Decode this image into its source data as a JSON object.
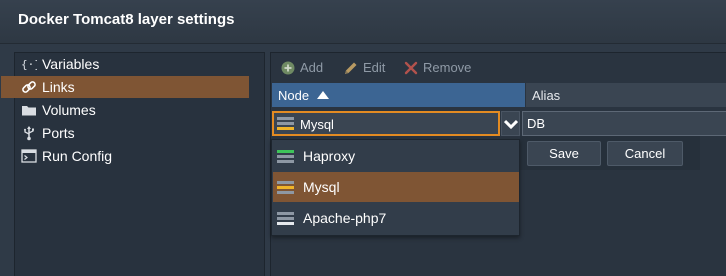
{
  "window": {
    "title": "Docker Tomcat8 layer settings"
  },
  "sidebar": {
    "items": [
      {
        "label": "Variables",
        "icon": "variables-icon",
        "active": false
      },
      {
        "label": "Links",
        "icon": "link-icon",
        "active": true
      },
      {
        "label": "Volumes",
        "icon": "folder-icon",
        "active": false
      },
      {
        "label": "Ports",
        "icon": "usb-port-icon",
        "active": false
      },
      {
        "label": "Run Config",
        "icon": "terminal-icon",
        "active": false
      }
    ]
  },
  "toolbar": {
    "add_label": "Add",
    "edit_label": "Edit",
    "remove_label": "Remove",
    "icons": [
      "plus-circle-icon",
      "pencil-icon",
      "x-icon"
    ]
  },
  "table": {
    "columns": [
      {
        "label": "Node",
        "sort": "ascending"
      },
      {
        "label": "Alias"
      }
    ]
  },
  "editor": {
    "node_value": "Mysql",
    "alias_value": "DB",
    "save_label": "Save",
    "cancel_label": "Cancel"
  },
  "dropdown": {
    "options": [
      {
        "label": "Haproxy",
        "status_color": "#3ec45a",
        "selected": false
      },
      {
        "label": "Mysql",
        "status_color": "#f0b429",
        "selected": true
      },
      {
        "label": "Apache-php7",
        "status_color": "#e6e9ed",
        "selected": false
      }
    ]
  },
  "colors": {
    "accent": "#e38b22",
    "active_row": "#7f5534",
    "header_blue": "#3c6593",
    "background": "#2f3a47"
  }
}
